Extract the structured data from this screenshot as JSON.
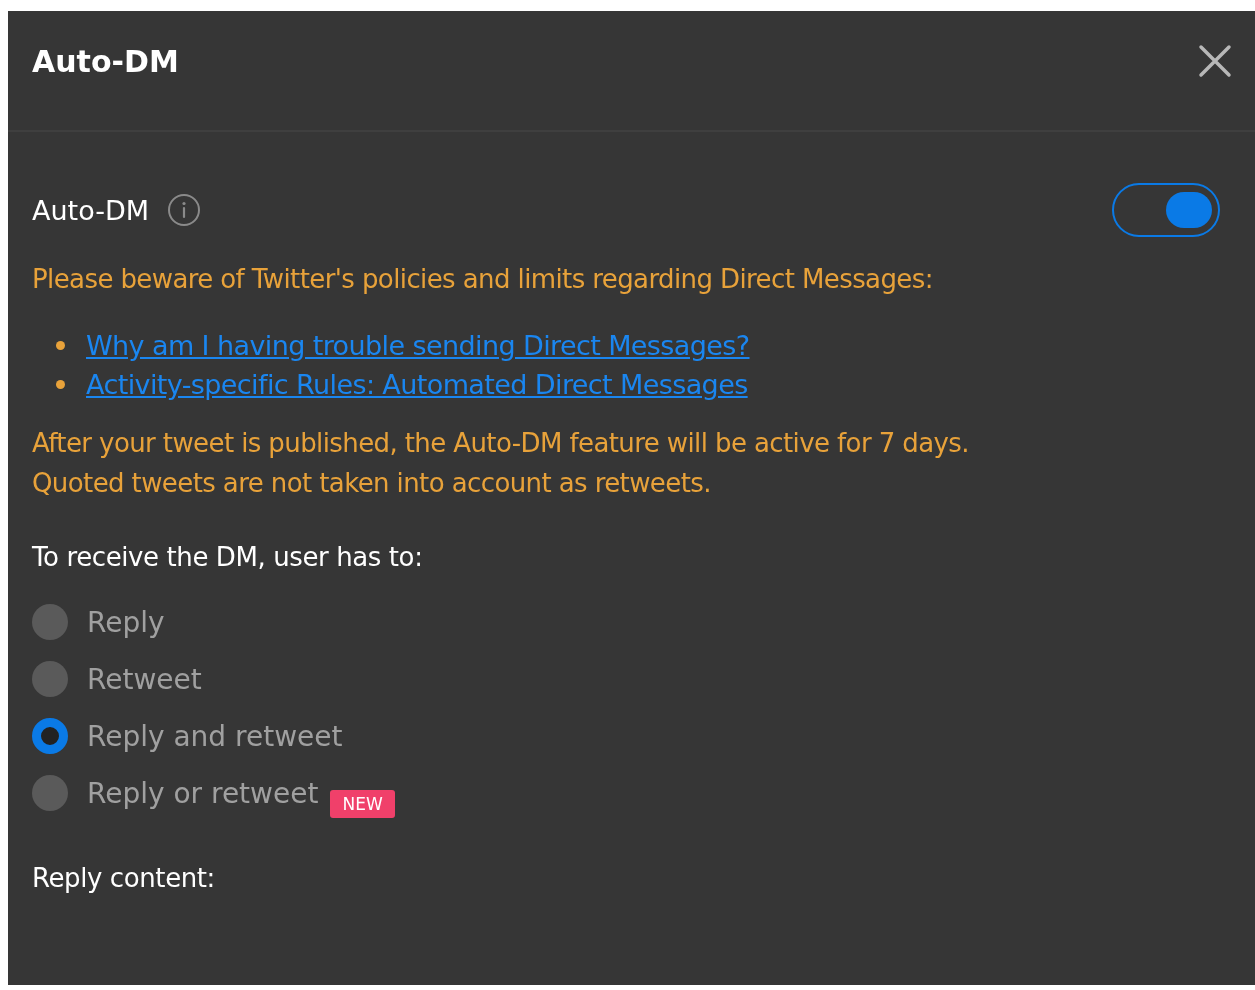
{
  "dialog": {
    "title": "Auto-DM"
  },
  "auto_dm": {
    "label": "Auto-DM",
    "on": true
  },
  "warning": "Please beware of Twitter's policies and limits regarding Direct Messages:",
  "links": [
    "Why am I having trouble sending Direct Messages?",
    "Activity-specific Rules: Automated Direct Messages"
  ],
  "notes": [
    "After your tweet is published, the Auto-DM feature will be active for 7 days.",
    "Quoted tweets are not taken into account as retweets."
  ],
  "condition_heading": "To receive the DM, user has to:",
  "options": [
    {
      "label": "Reply",
      "selected": false
    },
    {
      "label": "Retweet",
      "selected": false
    },
    {
      "label": "Reply and retweet",
      "selected": true
    },
    {
      "label": "Reply or retweet",
      "selected": false,
      "badge": "NEW"
    }
  ],
  "reply_content_heading": "Reply content:"
}
